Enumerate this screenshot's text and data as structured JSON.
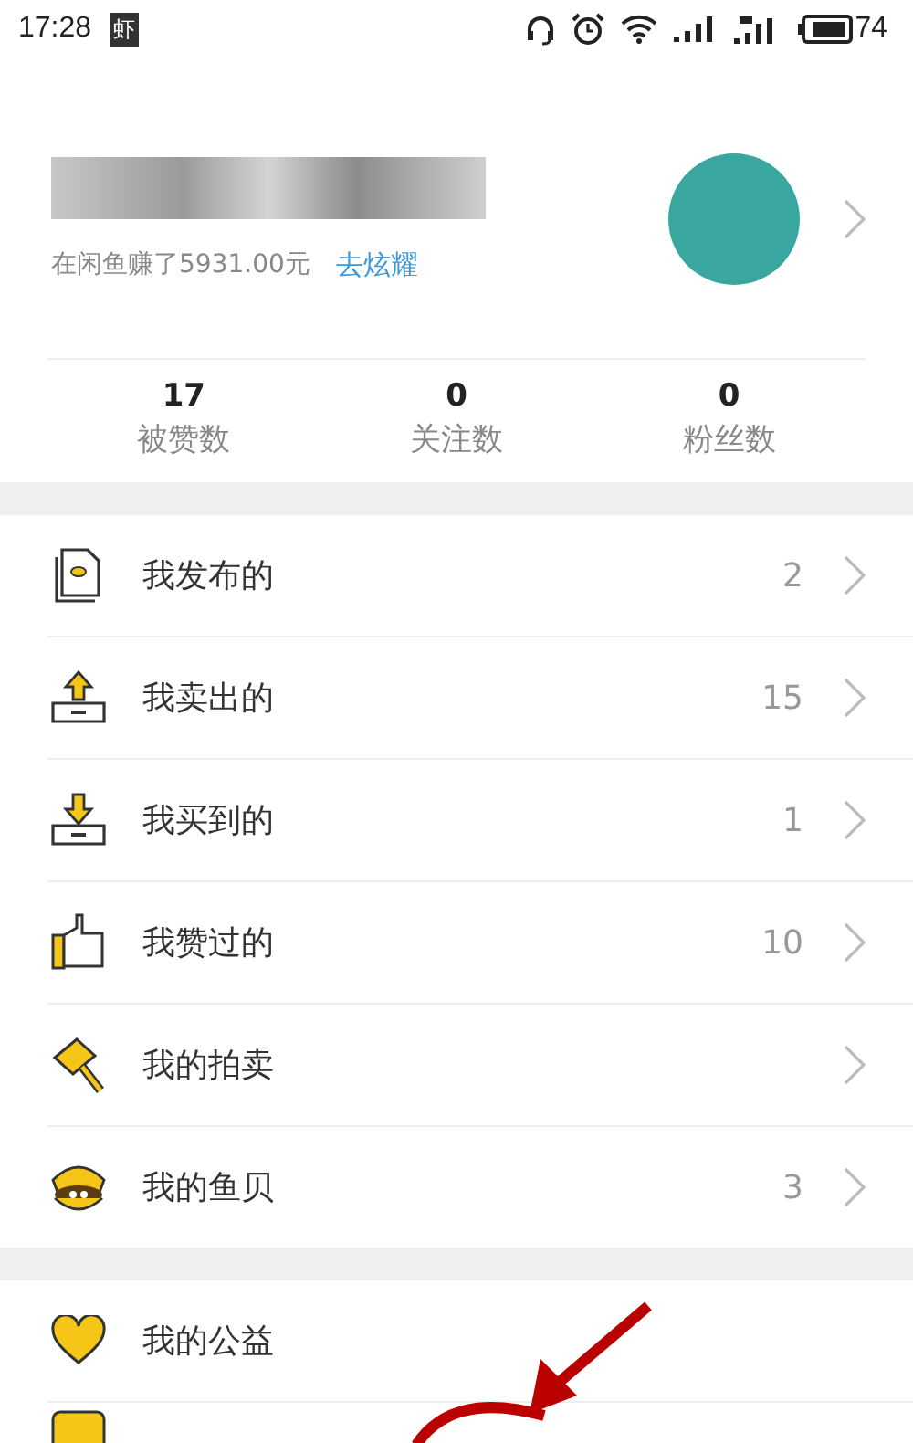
{
  "status_bar": {
    "time": "17:28",
    "app_badge": "虾",
    "battery": "74"
  },
  "profile": {
    "earnings": "在闲鱼赚了5931.00元",
    "share_link": "去炫耀"
  },
  "stats": [
    {
      "value": "17",
      "label": "被赞数"
    },
    {
      "value": "0",
      "label": "关注数"
    },
    {
      "value": "0",
      "label": "粉丝数"
    }
  ],
  "menu_groups": [
    {
      "items": [
        {
          "kind": "published",
          "label": "我发布的",
          "count": "2"
        },
        {
          "kind": "sold",
          "label": "我卖出的",
          "count": "15"
        },
        {
          "kind": "bought",
          "label": "我买到的",
          "count": "1"
        },
        {
          "kind": "liked",
          "label": "我赞过的",
          "count": "10"
        },
        {
          "kind": "auction",
          "label": "我的拍卖"
        },
        {
          "kind": "shells",
          "label": "我的鱼贝",
          "count": "3"
        }
      ]
    },
    {
      "items": [
        {
          "kind": "charity",
          "label": "我的公益"
        },
        {
          "kind": "partial"
        }
      ]
    }
  ]
}
